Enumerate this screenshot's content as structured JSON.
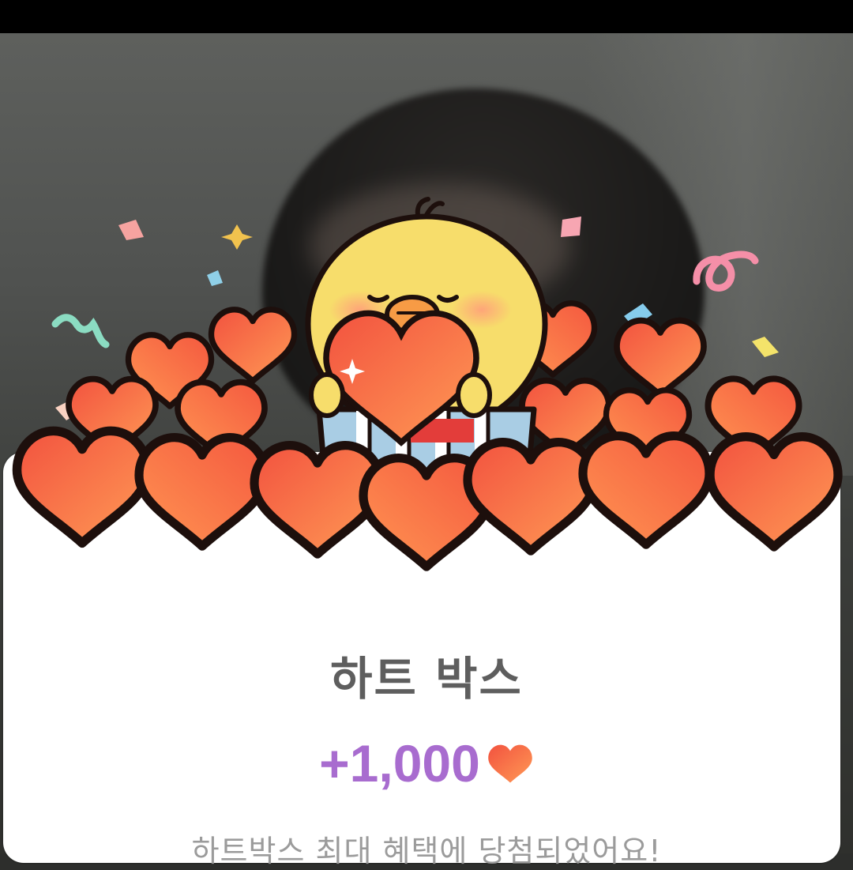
{
  "popup": {
    "title": "하트 박스",
    "reward_amount": "+1,000",
    "message": "하트박스 최대 혜택에 당첨되었어요!"
  },
  "colors": {
    "title_text": "#5e5e5e",
    "reward_text": "#a86ccf",
    "heart_light": "#ff9a55",
    "heart_dark": "#f2523f",
    "chick_body": "#f7dd6b",
    "message_text": "#9b9b9b"
  },
  "icons": {
    "reward": "heart-icon",
    "mascot": "chick-icon"
  }
}
